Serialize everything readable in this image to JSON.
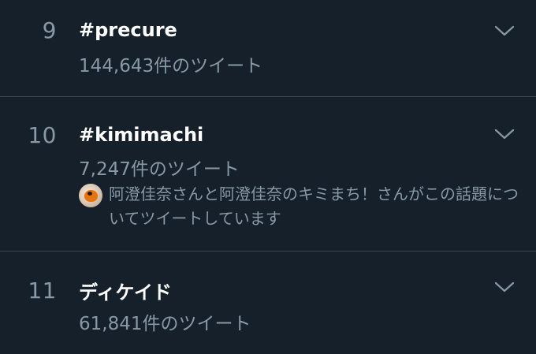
{
  "trends": [
    {
      "rank": "9",
      "name": "#precure",
      "count": "144,643件のツイート"
    },
    {
      "rank": "10",
      "name": "#kimimachi",
      "count": "7,247件のツイート",
      "context": "阿澄佳奈さんと阿澄佳奈のキミまち！さんがこの話題についてツイートしています"
    },
    {
      "rank": "11",
      "name": "ディケイド",
      "count": "61,841件のツイート"
    }
  ],
  "icons": {
    "chevron": "chevron-down-icon",
    "avatar": "user-avatar"
  },
  "colors": {
    "background": "#15202b",
    "primary_text": "#ffffff",
    "secondary_text": "#8899a6",
    "divider": "#38444d"
  }
}
